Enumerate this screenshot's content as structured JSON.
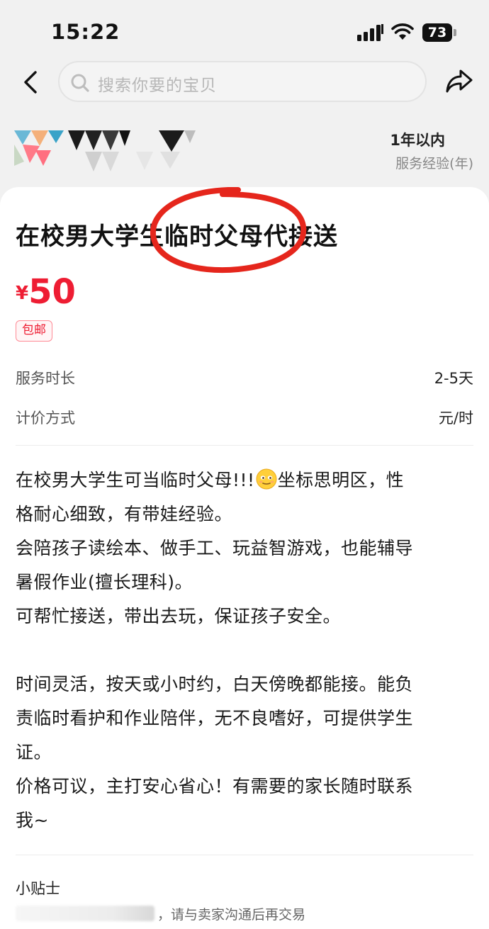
{
  "status_bar": {
    "time": "15:22",
    "battery": "73"
  },
  "search": {
    "placeholder": "搜索你要的宝贝"
  },
  "seller": {
    "experience_value": "1年以内",
    "experience_label": "服务经验(年)"
  },
  "listing": {
    "title": "在校男大学生临时父母代接送",
    "price_symbol": "¥",
    "price": "50",
    "badge": "包邮",
    "specs": [
      {
        "label": "服务时长",
        "value": "2-5天"
      },
      {
        "label": "计价方式",
        "value": "元/时"
      }
    ],
    "description": {
      "line1a": "在校男大学生可当临时父母!!!",
      "line1b": "坐标思明区，性",
      "line2": "格耐心细致，有带娃经验。",
      "line3": "会陪孩子读绘本、做手工、玩益智游戏，也能辅导",
      "line4": "暑假作业(擅长理科)。",
      "line5": "可帮忙接送，带出去玩，保证孩子安全。",
      "line6": "时间灵活，按天或小时约，白天傍晚都能接。能负",
      "line7": "责临时看护和作业陪伴，无不良嗜好，可提供学生",
      "line8": "证。",
      "line9": "价格可议，主打安心省心！有需要的家长随时联系",
      "line10": "我~"
    }
  },
  "tips": {
    "title": "小贴士",
    "text": "，请与卖家沟通后再交易"
  },
  "colors": {
    "price": "#ee1d33",
    "annotation": "#e5261c"
  },
  "icons": [
    "back-icon",
    "search-icon",
    "share-icon",
    "signal-icon",
    "wifi-icon",
    "battery-icon",
    "smiling-face-emoji"
  ]
}
